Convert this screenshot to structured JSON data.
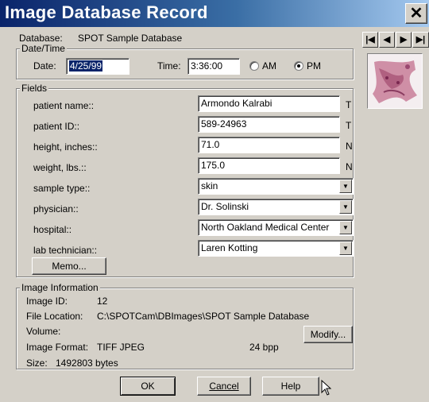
{
  "window": {
    "title": "Image Database Record",
    "close_glyph": "✕"
  },
  "database": {
    "label": "Database:",
    "value": "SPOT Sample Database"
  },
  "datetime": {
    "legend": "Date/Time",
    "date_label": "Date:",
    "date_value": "4/25/99",
    "time_label": "Time:",
    "time_value": "3:36:00",
    "am_label": "AM",
    "pm_label": "PM",
    "selected_period": "PM"
  },
  "fields": {
    "legend": "Fields",
    "rows": [
      {
        "label": "patient name::",
        "value": "Armondo Kalrabi",
        "type": "T"
      },
      {
        "label": "patient ID::",
        "value": "589-24963",
        "type": "T"
      },
      {
        "label": "height, inches::",
        "value": "71.0",
        "type": "N"
      },
      {
        "label": "weight, lbs.::",
        "value": "175.0",
        "type": "N"
      },
      {
        "label": "sample type::",
        "value": "skin"
      },
      {
        "label": "physician::",
        "value": "Dr. Solinski"
      },
      {
        "label": "hospital::",
        "value": "North Oakland Medical Center"
      },
      {
        "label": "lab technician::",
        "value": "Laren Kotting"
      }
    ],
    "memo_button": "Memo..."
  },
  "image_info": {
    "legend": "Image Information",
    "id_label": "Image ID:",
    "id_value": "12",
    "location_label": "File Location:",
    "location_value": "C:\\SPOTCam\\DBImages\\SPOT Sample Database",
    "volume_label": "Volume:",
    "modify_button": "Modify...",
    "format_label": "Image Format:",
    "format_value": "TIFF JPEG",
    "bpp_value": "24  bpp",
    "size_label": "Size:",
    "size_value": "1492803 bytes"
  },
  "buttons": {
    "ok": "OK",
    "cancel": "Cancel",
    "help": "Help"
  },
  "nav": {
    "first": "|◀",
    "prev": "◀",
    "next": "▶",
    "last": "▶|"
  },
  "icons": {
    "dropdown": "chevron-down-icon",
    "pointer": "mouse-pointer-icon",
    "thumbnail": "tissue-sample-thumbnail"
  }
}
